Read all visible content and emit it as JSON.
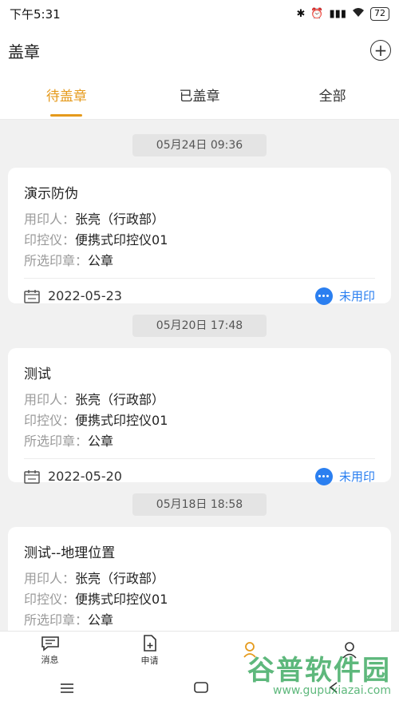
{
  "status_bar": {
    "time": "下午5:31",
    "battery": "72"
  },
  "header": {
    "title": "盖章"
  },
  "tabs": [
    {
      "label": "待盖章",
      "active": true
    },
    {
      "label": "已盖章",
      "active": false
    },
    {
      "label": "全部",
      "active": false
    }
  ],
  "records": [
    {
      "timestamp": "05月24日 09:36",
      "title": "演示防伪",
      "user_label": "用印人：",
      "user_value": "张亮（行政部）",
      "device_label": "印控仪：",
      "device_value": "便携式印控仪01",
      "seal_label": "所选印章：",
      "seal_value": "公章",
      "date": "2022-05-23",
      "status": "未用印"
    },
    {
      "timestamp": "05月20日 17:48",
      "title": "测试",
      "user_label": "用印人：",
      "user_value": "张亮（行政部）",
      "device_label": "印控仪：",
      "device_value": "便携式印控仪01",
      "seal_label": "所选印章：",
      "seal_value": "公章",
      "date": "2022-05-20",
      "status": "未用印"
    },
    {
      "timestamp": "05月18日 18:58",
      "title": "测试--地理位置",
      "user_label": "用印人：",
      "user_value": "张亮（行政部）",
      "device_label": "印控仪：",
      "device_value": "便携式印控仪01",
      "seal_label": "所选印章：",
      "seal_value": "公章",
      "date": "",
      "status": ""
    }
  ],
  "bottom_nav": [
    {
      "label": "消息",
      "icon": "message-icon"
    },
    {
      "label": "申请",
      "icon": "apply-icon"
    },
    {
      "label": "",
      "icon": "stamp-icon"
    },
    {
      "label": "",
      "icon": "profile-icon"
    }
  ],
  "watermark": {
    "main": "谷普软件园",
    "url": "www.gupuxiazai.com"
  },
  "colors": {
    "accent": "#e59a1c",
    "status_blue": "#2b7ff0"
  }
}
